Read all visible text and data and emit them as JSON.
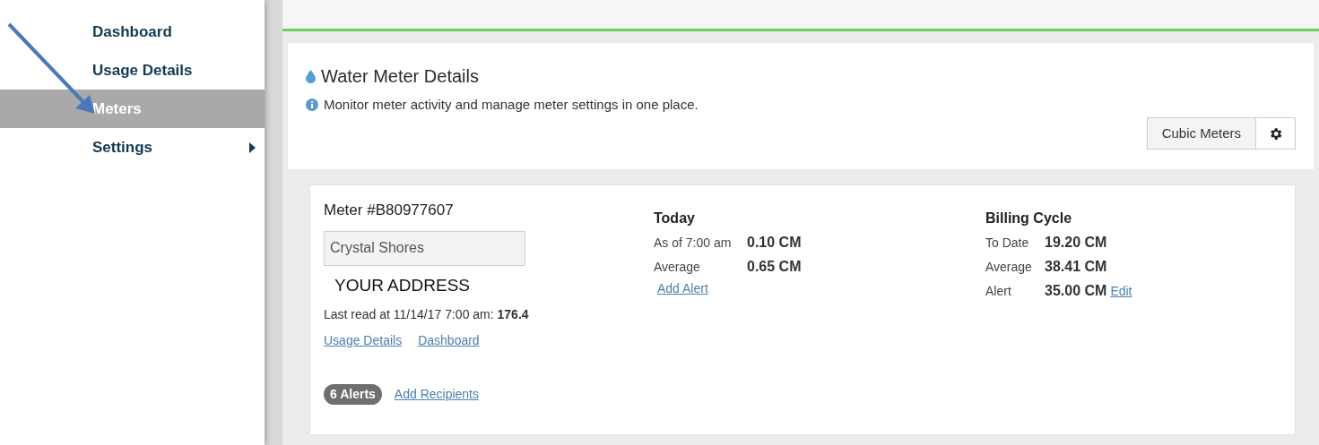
{
  "sidebar": {
    "items": [
      {
        "label": "Dashboard",
        "selected": false,
        "has_submenu": false
      },
      {
        "label": "Usage Details",
        "selected": false,
        "has_submenu": false
      },
      {
        "label": "Meters",
        "selected": true,
        "has_submenu": false
      },
      {
        "label": "Settings",
        "selected": false,
        "has_submenu": true
      }
    ]
  },
  "header": {
    "title": "Water Meter Details",
    "info": "Monitor meter activity and manage meter settings in one place.",
    "unit_button": "Cubic Meters"
  },
  "meter": {
    "title": "Meter #B80977607",
    "name_value": "Crystal Shores",
    "address": "YOUR ADDRESS",
    "last_read": "Last read at 11/14/17 7:00 am: **176.4**",
    "links": [
      "Usage Details",
      "Dashboard"
    ],
    "alerts_badge": "6 Alerts",
    "add_recipients": "Add Recipients",
    "today": {
      "title": "Today",
      "rows": [
        {
          "label": "As of 7:00 am",
          "value": "0.10 CM"
        },
        {
          "label": "Average",
          "value": "0.65 CM"
        }
      ],
      "add_alert": "Add Alert"
    },
    "billing": {
      "title": "Billing Cycle",
      "rows": [
        {
          "label": "To Date",
          "value": "19.20 CM"
        },
        {
          "label": "Average",
          "value": "38.41 CM"
        },
        {
          "label": "Alert",
          "value": "35.00 CM",
          "link": "Edit"
        }
      ]
    }
  }
}
